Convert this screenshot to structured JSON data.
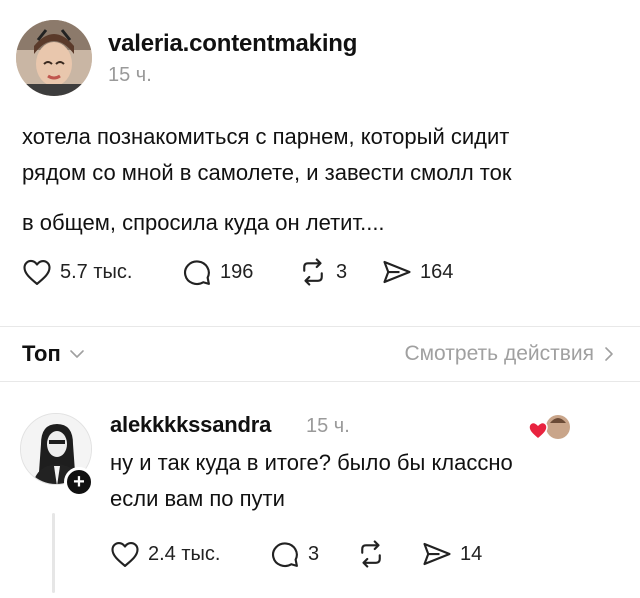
{
  "post": {
    "username": "valeria.contentmaking",
    "time": "15 ч.",
    "text_line1": "хотела познакомиться с парнем, который сидит",
    "text_line2": "рядом со мной в самолете, и завести смолл ток",
    "text_line3": "в общем, спросила куда он летит....",
    "likes": "5.7 тыс.",
    "comments": "196",
    "reposts": "3",
    "shares": "164"
  },
  "sort_bar": {
    "label": "Топ",
    "activity_link": "Смотреть действия"
  },
  "reply": {
    "username": "alekkkkssandra",
    "time": "15 ч.",
    "text_line1": "ну и так куда в итоге? было бы классно",
    "text_line2": "если вам по пути",
    "likes": "2.4 тыс.",
    "comments": "3",
    "shares": "14",
    "follow_glyph": "+"
  },
  "colors": {
    "text": "#111111",
    "muted": "#9a9a9a",
    "divider": "#e8e8e8",
    "heart_red": "#e8233f"
  },
  "icons": [
    "heart-icon",
    "comment-icon",
    "repost-icon",
    "share-icon",
    "chevron-down-icon",
    "chevron-right-icon",
    "plus-icon"
  ]
}
